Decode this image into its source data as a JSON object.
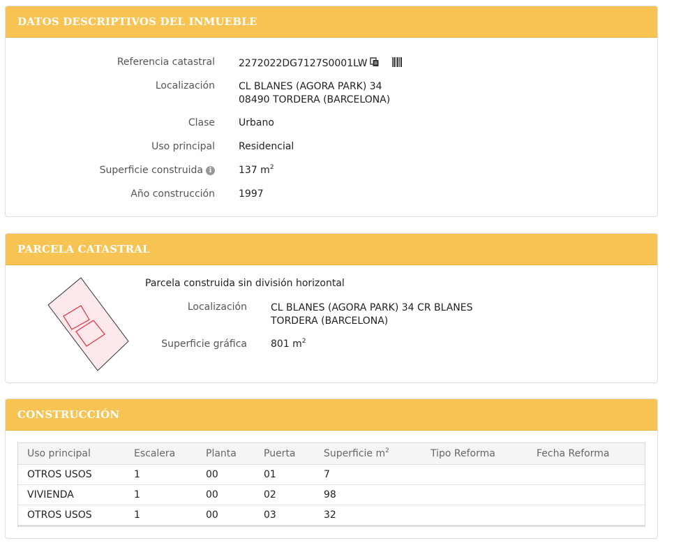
{
  "datos": {
    "title": "DATOS DESCRIPTIVOS DEL INMUEBLE",
    "referencia_label": "Referencia catastral",
    "referencia_value": "2272022DG7127S0001LW",
    "localizacion_label": "Localización",
    "localizacion_line1": "CL BLANES (AGORA PARK) 34",
    "localizacion_line2": "08490 TORDERA (BARCELONA)",
    "clase_label": "Clase",
    "clase_value": "Urbano",
    "uso_label": "Uso principal",
    "uso_value": "Residencial",
    "superficie_label": "Superficie construida",
    "superficie_value": "137 m",
    "superficie_unit_sup": "2",
    "anio_label": "Año construcción",
    "anio_value": "1997"
  },
  "parcela": {
    "title": "PARCELA CATASTRAL",
    "note": "Parcela construida sin división horizontal",
    "localizacion_label": "Localización",
    "localizacion_line1": "CL BLANES (AGORA PARK) 34 CR BLANES",
    "localizacion_line2": "TORDERA (BARCELONA)",
    "superficie_label": "Superficie gráfica",
    "superficie_value": "801 m",
    "superficie_unit_sup": "2"
  },
  "construccion": {
    "title": "CONSTRUCCIÓN",
    "headers": [
      "Uso principal",
      "Escalera",
      "Planta",
      "Puerta",
      "Superficie m",
      "Tipo Reforma",
      "Fecha Reforma"
    ],
    "superficie_header_sup": "2",
    "rows": [
      [
        "OTROS USOS",
        "1",
        "00",
        "01",
        "7",
        "",
        ""
      ],
      [
        "VIVIENDA",
        "1",
        "00",
        "02",
        "98",
        "",
        ""
      ],
      [
        "OTROS USOS",
        "1",
        "00",
        "03",
        "32",
        "",
        ""
      ]
    ]
  },
  "icons": [
    "copy-icon",
    "barcode-icon",
    "info-icon"
  ],
  "colors": {
    "header_bg": "#f7c453",
    "header_text": "#ffffff",
    "parcel_fill": "#fde8ec",
    "parcel_building": "#e0303a"
  }
}
